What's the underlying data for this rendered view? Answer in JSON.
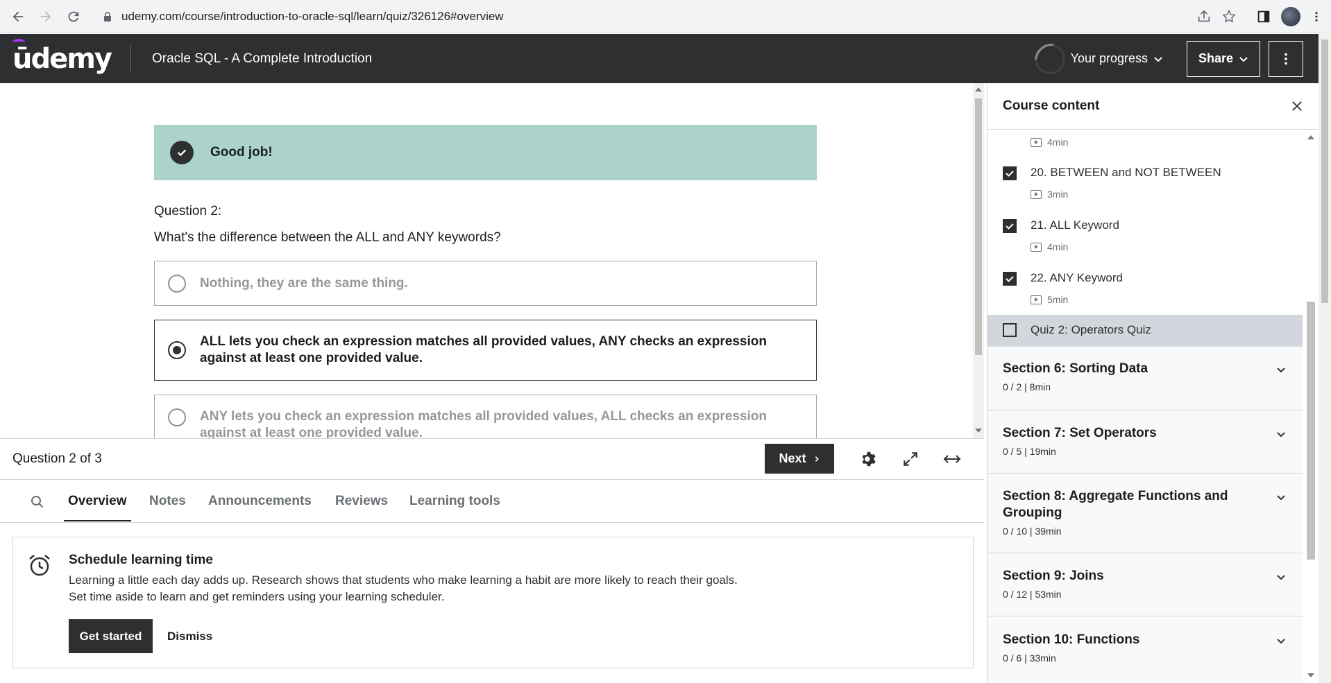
{
  "browser": {
    "url": "udemy.com/course/introduction-to-oracle-sql/learn/quiz/326126#overview"
  },
  "header": {
    "logo": "ūdemy",
    "course_title": "Oracle SQL - A Complete Introduction",
    "progress_label": "Your progress",
    "share_label": "Share"
  },
  "quiz": {
    "feedback": "Good job!",
    "question_number": "Question 2:",
    "question_text": "What's the difference between the ALL and ANY keywords?",
    "answers": [
      {
        "text": "Nothing, they are the same thing.",
        "selected": false
      },
      {
        "text": "ALL lets you check an expression matches all provided values, ANY checks an expression against at least one provided value.",
        "selected": true
      },
      {
        "text": "ANY lets you check an expression matches all provided values, ALL checks an expression against at least one provided value.",
        "selected": false
      }
    ]
  },
  "player_bar": {
    "progress": "Question 2 of 3",
    "next_label": "Next"
  },
  "tabs": [
    "Overview",
    "Notes",
    "Announcements",
    "Reviews",
    "Learning tools"
  ],
  "schedule": {
    "title": "Schedule learning time",
    "line1": "Learning a little each day adds up. Research shows that students who make learning a habit are more likely to reach their goals.",
    "line2": "Set time aside to learn and get reminders using your learning scheduler.",
    "get_started": "Get started",
    "dismiss": "Dismiss"
  },
  "sidebar": {
    "title": "Course content",
    "lessons": [
      {
        "title": "",
        "duration": "4min",
        "checked": true
      },
      {
        "title": "20. BETWEEN and NOT BETWEEN",
        "duration": "3min",
        "checked": true
      },
      {
        "title": "21. ALL Keyword",
        "duration": "4min",
        "checked": true
      },
      {
        "title": "22. ANY Keyword",
        "duration": "5min",
        "checked": true
      },
      {
        "title": "Quiz 2: Operators Quiz",
        "duration": "",
        "checked": false
      }
    ],
    "sections": [
      {
        "title": "Section 6: Sorting Data",
        "meta": "0 / 2 | 8min"
      },
      {
        "title": "Section 7: Set Operators",
        "meta": "0 / 5 | 19min"
      },
      {
        "title": "Section 8: Aggregate Functions and Grouping",
        "meta": "0 / 10 | 39min"
      },
      {
        "title": "Section 9: Joins",
        "meta": "0 / 12 | 53min"
      },
      {
        "title": "Section 10: Functions",
        "meta": "0 / 6 | 33min"
      }
    ]
  },
  "colors": {
    "header_bg": "#2d2f31",
    "success_bg": "#acd2cc",
    "brand_accent": "#a435f0"
  }
}
